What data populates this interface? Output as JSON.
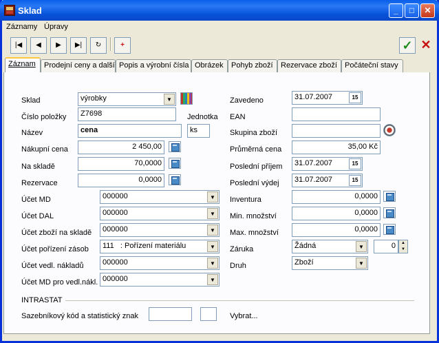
{
  "window": {
    "title": "Sklad"
  },
  "menu": {
    "items": [
      "Záznamy",
      "Úpravy"
    ]
  },
  "toolbar": {
    "first": "|◀",
    "prev": "◀",
    "next": "▶",
    "last": "▶|",
    "refresh": "↻",
    "extra": "+"
  },
  "tabs": [
    "Záznam",
    "Prodejní ceny a další",
    "Popis a výrobní čísla",
    "Obrázek",
    "Pohyb zboží",
    "Rezervace zboží",
    "Počáteční stavy"
  ],
  "form": {
    "sklad_label": "Sklad",
    "sklad_value": "výrobky",
    "cislo_label": "Číslo položky",
    "cislo_value": "Z7698",
    "jednotka_label": "Jednotka",
    "jednotka_value": "ks",
    "nazev_label": "Název",
    "nazev_value": "cena",
    "nakupni_label": "Nákupní cena",
    "nakupni_value": "2 450,00",
    "nasklade_label": "Na skladě",
    "nasklade_value": "70,0000",
    "rezervace_label": "Rezervace",
    "rezervace_value": "0,0000",
    "ucet_md_label": "Účet MD",
    "ucet_md_value": "000000",
    "ucet_dal_label": "Účet DAL",
    "ucet_dal_value": "000000",
    "ucet_zbozi_label": "Účet zboží na skladě",
    "ucet_zbozi_value": "000000",
    "ucet_poriz_label": "Účet pořízení zásob",
    "ucet_poriz_value": "111   : Pořízení materiálu",
    "ucet_vedl_label": "Účet vedl. nákladů",
    "ucet_vedl_value": "000000",
    "ucet_md_vedl_label": "Účet MD pro vedl.nákl.",
    "ucet_md_vedl_value": "000000",
    "zavedeno_label": "Zavedeno",
    "zavedeno_value": "31.07.2007",
    "ean_label": "EAN",
    "ean_value": "",
    "skupina_label": "Skupina zboží",
    "skupina_value": "",
    "prumerna_label": "Průměrná cena",
    "prumerna_value": "35,00 Kč",
    "posl_prijem_label": "Poslední příjem",
    "posl_prijem_value": "31.07.2007",
    "posl_vydej_label": "Poslední výdej",
    "posl_vydej_value": "31.07.2007",
    "inventura_label": "Inventura",
    "inventura_value": "0,0000",
    "min_label": "Min. množství",
    "min_value": "0,0000",
    "max_label": "Max. množství",
    "max_value": "0,0000",
    "zaruka_label": "Záruka",
    "zaruka_value": "Žádná",
    "zaruka_num": "0",
    "druh_label": "Druh",
    "druh_value": "Zboží",
    "intrastat_label": "INTRASTAT",
    "sazebnik_label": "Sazebníkový kód a statistický znak",
    "vybrat_label": "Vybrat..."
  }
}
